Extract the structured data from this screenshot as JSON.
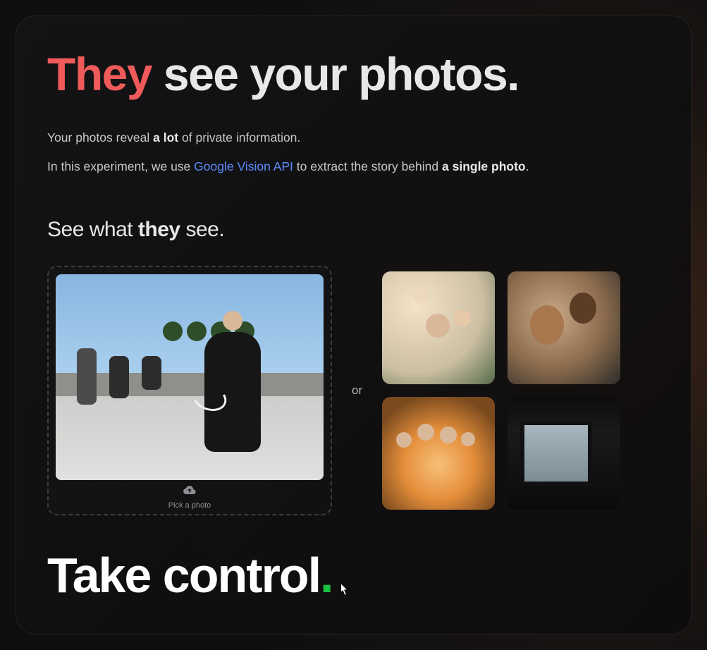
{
  "hero": {
    "title_red": "They",
    "title_rest": " see your photos.",
    "sub1_a": "Your photos reveal ",
    "sub1_b": "a lot",
    "sub1_c": " of private information.",
    "sub2_a": "In this experiment, we use ",
    "sub2_link": "Google Vision API",
    "sub2_b": " to extract the story behind ",
    "sub2_bold": "a single photo",
    "sub2_c": "."
  },
  "section": {
    "see_a": "See what ",
    "see_b": "they",
    "see_c": " see."
  },
  "upload": {
    "label": "Pick a photo",
    "or": "or"
  },
  "thumbs": {
    "alt1": "Family with two kids on shoulders",
    "alt2": "Two people close together wearing glasses",
    "alt3": "Family of five in a flower field at sunset",
    "alt4": "Dark room with a window view of a city skyline"
  },
  "bottom": {
    "text": "Take control",
    "dot": "."
  }
}
